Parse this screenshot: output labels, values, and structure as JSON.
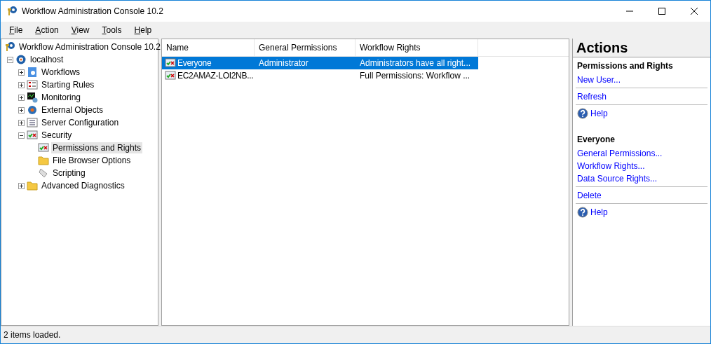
{
  "window": {
    "title": "Workflow Administration Console 10.2"
  },
  "menu": [
    "File",
    "Action",
    "View",
    "Tools",
    "Help"
  ],
  "tree": {
    "label": "Workflow Administration Console 10.2",
    "children": [
      {
        "label": "localhost",
        "expanded": true,
        "children": [
          {
            "label": "Workflows",
            "expanded": false
          },
          {
            "label": "Starting Rules",
            "expanded": false
          },
          {
            "label": "Monitoring",
            "expanded": false
          },
          {
            "label": "External Objects",
            "expanded": false
          },
          {
            "label": "Server Configuration",
            "expanded": false
          },
          {
            "label": "Security",
            "expanded": true,
            "children": [
              {
                "label": "Permissions and Rights",
                "selected": true
              },
              {
                "label": "File Browser Options",
                "selected": false
              },
              {
                "label": "Scripting",
                "selected": false
              }
            ]
          },
          {
            "label": "Advanced Diagnostics",
            "expanded": false
          }
        ]
      }
    ]
  },
  "table": {
    "columns": [
      "Name",
      "General Permissions",
      "Workflow Rights"
    ],
    "rows": [
      {
        "name": "Everyone",
        "general": "Administrator",
        "rights": "Administrators have all right...",
        "selected": true
      },
      {
        "name": "EC2AMAZ-LOI2NB...",
        "general": "",
        "rights": "Full Permissions: Workflow ...",
        "selected": false
      }
    ]
  },
  "actions": {
    "title": "Actions",
    "sections": [
      {
        "title": "Permissions and Rights",
        "items": [
          {
            "kind": "link",
            "label": "New User..."
          },
          {
            "kind": "separator"
          },
          {
            "kind": "link",
            "label": "Refresh"
          },
          {
            "kind": "separator"
          },
          {
            "kind": "help",
            "label": "Help"
          }
        ]
      },
      {
        "title": "Everyone",
        "items": [
          {
            "kind": "link",
            "label": "General Permissions..."
          },
          {
            "kind": "link",
            "label": "Workflow Rights..."
          },
          {
            "kind": "link",
            "label": "Data Source Rights..."
          },
          {
            "kind": "separator"
          },
          {
            "kind": "link",
            "label": "Delete"
          },
          {
            "kind": "separator"
          },
          {
            "kind": "help",
            "label": "Help"
          }
        ]
      }
    ]
  },
  "status_bar": "2 items loaded."
}
